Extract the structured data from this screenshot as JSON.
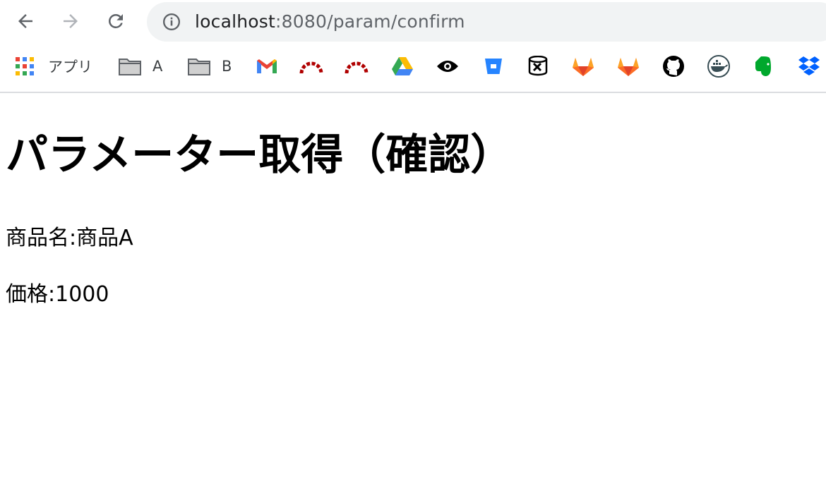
{
  "browser": {
    "url_host": "localhost",
    "url_path": ":8080/param/confirm"
  },
  "bookmarks": {
    "apps_label": "アプリ",
    "folder_a": "A",
    "folder_b": "B",
    "icons": [
      "gmail-icon",
      "redmine-icon",
      "redmine-icon",
      "google-drive-icon",
      "eye-icon",
      "bitbucket-icon",
      "zapier-icon",
      "gitlab-icon",
      "gitlab-icon",
      "github-icon",
      "docker-icon",
      "evernote-icon",
      "dropbox-icon"
    ]
  },
  "page": {
    "title": "パラメーター取得（確認）",
    "product_line": "商品名:商品A",
    "price_line": "価格:1000"
  }
}
